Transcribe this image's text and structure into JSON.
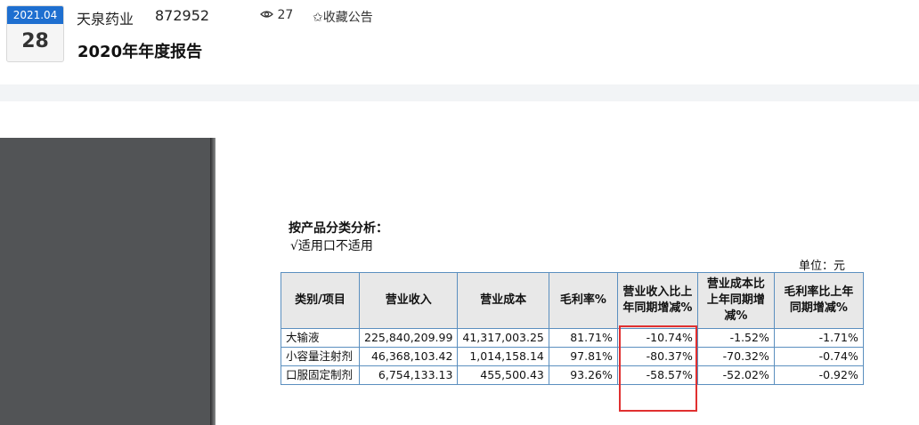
{
  "header": {
    "date_ym": "2021.04",
    "date_day": "28",
    "company": "天泉药业",
    "stock_code": "872952",
    "views": "27",
    "favorite_label": "✩收藏公告",
    "report_title": "2020年年度报告"
  },
  "document": {
    "heading": "按产品分类分析：",
    "applicable": "√适用口不适用",
    "unit": "单位：元",
    "columns": [
      "类别/项目",
      "营业收入",
      "营业成本",
      "毛利率%",
      "营业收入比上年同期增减%",
      "营业成本比上年同期增减%",
      "毛利率比上年同期增减%"
    ],
    "rows": [
      [
        "大输液",
        "225,840,209.99",
        "41,317,003.25",
        "81.71%",
        "-10.74%",
        "-1.52%",
        "-1.71%"
      ],
      [
        "小容量注射剂",
        "46,368,103.42",
        "1,014,158.14",
        "97.81%",
        "-80.37%",
        "-70.32%",
        "-0.74%"
      ],
      [
        "口服固定制剂",
        "6,754,133.13",
        "455,500.43",
        "93.26%",
        "-58.57%",
        "-52.02%",
        "-0.92%"
      ]
    ]
  },
  "colors": {
    "date_accent": "#1e6fd0",
    "highlight_box": "#e03030",
    "table_border": "#5b8fbf"
  },
  "icons": {
    "views": "eye-icon",
    "favorite": "star-outline-icon"
  }
}
